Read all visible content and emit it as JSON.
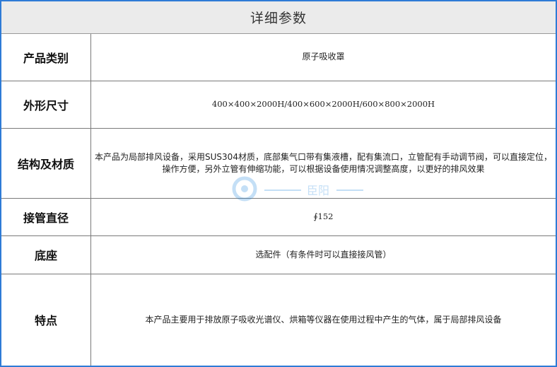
{
  "title": "详细参数",
  "rows": [
    {
      "label": "产品类别",
      "value": "原子吸收罩"
    },
    {
      "label": "外形尺寸",
      "value": "400×400×2000H/400×600×2000H/600×800×2000H"
    },
    {
      "label": "结构及材质",
      "value": "本产品为局部排风设备，采用SUS304材质，底部集气口带有集液槽，配有集流口，立管配有手动调节阀，可以直接定位，操作方便，另外立管有伸缩功能，可以根据设备使用情况调整高度，以更好的排风效果"
    },
    {
      "label": "接管直径",
      "value": "∮152"
    },
    {
      "label": "底座",
      "value": "选配件（有条件时可以直接接风管）"
    },
    {
      "label": "特点",
      "value": "本产品主要用于排放原子吸收光谱仪、烘箱等仪器在使用过程中产生的气体，属于局部排风设备"
    }
  ],
  "watermark": {
    "brand_text": "臣阳",
    "color": "#2e8ee0"
  }
}
